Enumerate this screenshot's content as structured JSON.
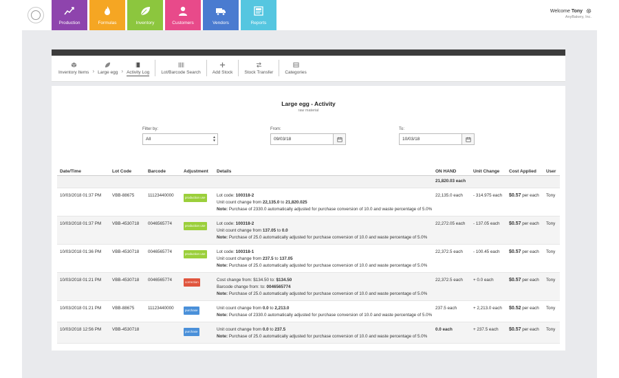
{
  "header": {
    "tiles": [
      {
        "label": "Production",
        "color": "#8e44ad",
        "icon": "chart-icon"
      },
      {
        "label": "Formulas",
        "color": "#f5a623",
        "icon": "flame-icon"
      },
      {
        "label": "Inventory",
        "color": "#8cc63e",
        "icon": "leaf-icon"
      },
      {
        "label": "Customers",
        "color": "#e84a8a",
        "icon": "person-icon"
      },
      {
        "label": "Vendors",
        "color": "#4a7bd0",
        "icon": "truck-icon"
      },
      {
        "label": "Reports",
        "color": "#55c6e0",
        "icon": "report-icon"
      }
    ],
    "welcome_prefix": "Welcome",
    "user_name": "Tony",
    "company": "AnyBakery, Inc."
  },
  "toolbar": {
    "breadcrumb": [
      "Inventory Items",
      "Large egg",
      "Activity Log"
    ],
    "actions": [
      "Lot/Barcode Search",
      "Add Stock",
      "Stock Transfer",
      "Categories"
    ]
  },
  "page": {
    "title": "Large egg - Activity",
    "subtitle": "raw material"
  },
  "filters": {
    "filter_label": "Filter by:",
    "filter_value": "All",
    "from_label": "From:",
    "from_value": "09/03/18",
    "to_label": "To:",
    "to_value": "10/03/18"
  },
  "table": {
    "headers": [
      "Date/Time",
      "Lot Code",
      "Barcode",
      "Adjustment",
      "Details",
      "ON HAND",
      "Unit Change",
      "Cost Applied",
      "User"
    ],
    "total_on_hand": "21,820.03 each",
    "rows": [
      {
        "datetime": "10/03/2018 01:37 PM",
        "lot": "VBB-88675",
        "barcode": "11123440000",
        "adjustment": "production use",
        "badge_color": "#9bcf3b",
        "details": [
          {
            "pre": "Lot code: ",
            "bold": "100318-2",
            "post": ""
          },
          {
            "pre": "Unit count change from ",
            "bold": "22,135.0",
            "mid": " to ",
            "bold2": "21,820.025"
          },
          {
            "pre": "",
            "bold": "Note:",
            "post": " Purchase of 2330.0 automatically adjusted for purchase conversion of 10.0 and waste percentage of 5.0%"
          }
        ],
        "on_hand": "22,135.0 each",
        "unit_change": "- 314.975 each",
        "cost": "$0.57",
        "cost_unit": " per each",
        "user": "Tony"
      },
      {
        "datetime": "10/03/2018 01:37 PM",
        "lot": "VBB-4530718",
        "barcode": "0046565774",
        "adjustment": "production use",
        "badge_color": "#9bcf3b",
        "details": [
          {
            "pre": "Lot code: ",
            "bold": "100318-2",
            "post": ""
          },
          {
            "pre": "Unit count change from ",
            "bold": "137.05",
            "mid": " to ",
            "bold2": "0.0"
          },
          {
            "pre": "",
            "bold": "Note:",
            "post": " Purchase of 25.0 automatically adjusted for purchase conversion of 10.0 and waste percentage of 5.0%"
          }
        ],
        "on_hand": "22,272.05 each",
        "unit_change": "- 137.05 each",
        "cost": "$0.57",
        "cost_unit": " per each",
        "user": "Tony"
      },
      {
        "datetime": "10/03/2018 01:36 PM",
        "lot": "VBB-4530718",
        "barcode": "0046565774",
        "adjustment": "production use",
        "badge_color": "#9bcf3b",
        "details": [
          {
            "pre": "Lot code: ",
            "bold": "100318-1",
            "post": ""
          },
          {
            "pre": "Unit count change from ",
            "bold": "237.5",
            "mid": " to ",
            "bold2": "137.05"
          },
          {
            "pre": "",
            "bold": "Note:",
            "post": " Purchase of 25.0 automatically adjusted for purchase conversion of 10.0 and waste percentage of 5.0%"
          }
        ],
        "on_hand": "22,372.5 each",
        "unit_change": "- 100.45 each",
        "cost": "$0.57",
        "cost_unit": " per each",
        "user": "Tony"
      },
      {
        "datetime": "10/03/2018 01:21 PM",
        "lot": "VBB-4530718",
        "barcode": "0046565774",
        "adjustment": "correction",
        "badge_color": "#e0553e",
        "details": [
          {
            "pre": "Cost change from: $134.50 to: ",
            "bold": "$134.50",
            "post": ""
          },
          {
            "pre": "Barcode change from: to: ",
            "bold": "0046565774",
            "post": ""
          },
          {
            "pre": "",
            "bold": "Note:",
            "post": " Purchase of 25.0 automatically adjusted for purchase conversion of 10.0 and waste percentage of 5.0%"
          }
        ],
        "on_hand": "22,372.5 each",
        "unit_change": "+ 0.0 each",
        "cost": "$0.57",
        "cost_unit": " per each",
        "user": "Tony"
      },
      {
        "datetime": "10/03/2018 01:21 PM",
        "lot": "VBB-88675",
        "barcode": "11123440000",
        "adjustment": "purchase",
        "badge_color": "#4a90d9",
        "details": [
          {
            "pre": "Unit count change from ",
            "bold": "0.0",
            "mid": " to ",
            "bold2": "2,213.0"
          },
          {
            "pre": "",
            "bold": "Note:",
            "post": " Purchase of 2330.0 automatically adjusted for purchase conversion of 10.0 and waste percentage of 5.0%"
          }
        ],
        "on_hand": "237.5 each",
        "unit_change": "+ 2,213.0 each",
        "cost": "$0.52",
        "cost_unit": " per each",
        "user": "Tony"
      },
      {
        "datetime": "10/03/2018 12:56 PM",
        "lot": "VBB-4530718",
        "barcode": "",
        "adjustment": "purchase",
        "badge_color": "#4a90d9",
        "details": [
          {
            "pre": "Unit count change from ",
            "bold": "0.0",
            "mid": " to ",
            "bold2": "237.5"
          },
          {
            "pre": "",
            "bold": "Note:",
            "post": " Purchase of 25.0 automatically adjusted for purchase conversion of 10.0 and waste percentage of 5.0%"
          }
        ],
        "on_hand": "0.0 each",
        "on_hand_negative": true,
        "unit_change": "+ 237.5 each",
        "cost": "$0.57",
        "cost_unit": " per each",
        "user": "Tony"
      }
    ]
  }
}
